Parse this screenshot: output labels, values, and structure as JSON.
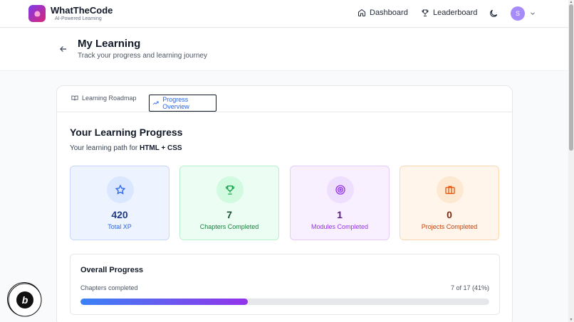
{
  "brand": {
    "name": "WhatTheCode",
    "tagline": "AI-Powered Learning"
  },
  "nav": {
    "dashboard_label": "Dashboard",
    "leaderboard_label": "Leaderboard",
    "avatar_initial": "S"
  },
  "header": {
    "title": "My Learning",
    "subtitle": "Track your progress and learning journey"
  },
  "tabs": [
    {
      "label": "Learning Roadmap",
      "icon": "book-open-icon",
      "active": false
    },
    {
      "label": "Progress Overview",
      "icon": "trending-up-icon",
      "active": true
    }
  ],
  "progress_section": {
    "title": "Your Learning Progress",
    "path_prefix": "Your learning path for",
    "path_name": "HTML + CSS"
  },
  "stats": [
    {
      "value": "420",
      "label": "Total XP",
      "icon": "star-icon",
      "color": "#2563eb"
    },
    {
      "value": "7",
      "label": "Chapters Completed",
      "icon": "trophy-icon",
      "color": "#16a34a"
    },
    {
      "value": "1",
      "label": "Modules Completed",
      "icon": "target-icon",
      "color": "#9333ea"
    },
    {
      "value": "0",
      "label": "Projects Completed",
      "icon": "briefcase-icon",
      "color": "#ea580c"
    }
  ],
  "overall": {
    "title": "Overall Progress",
    "label": "Chapters completed",
    "count_text": "7 of 17 (41%)",
    "fraction": 0.41
  },
  "badge": {
    "text": "POWERED BY BOLT · MADE IN BOLT.NEW"
  }
}
